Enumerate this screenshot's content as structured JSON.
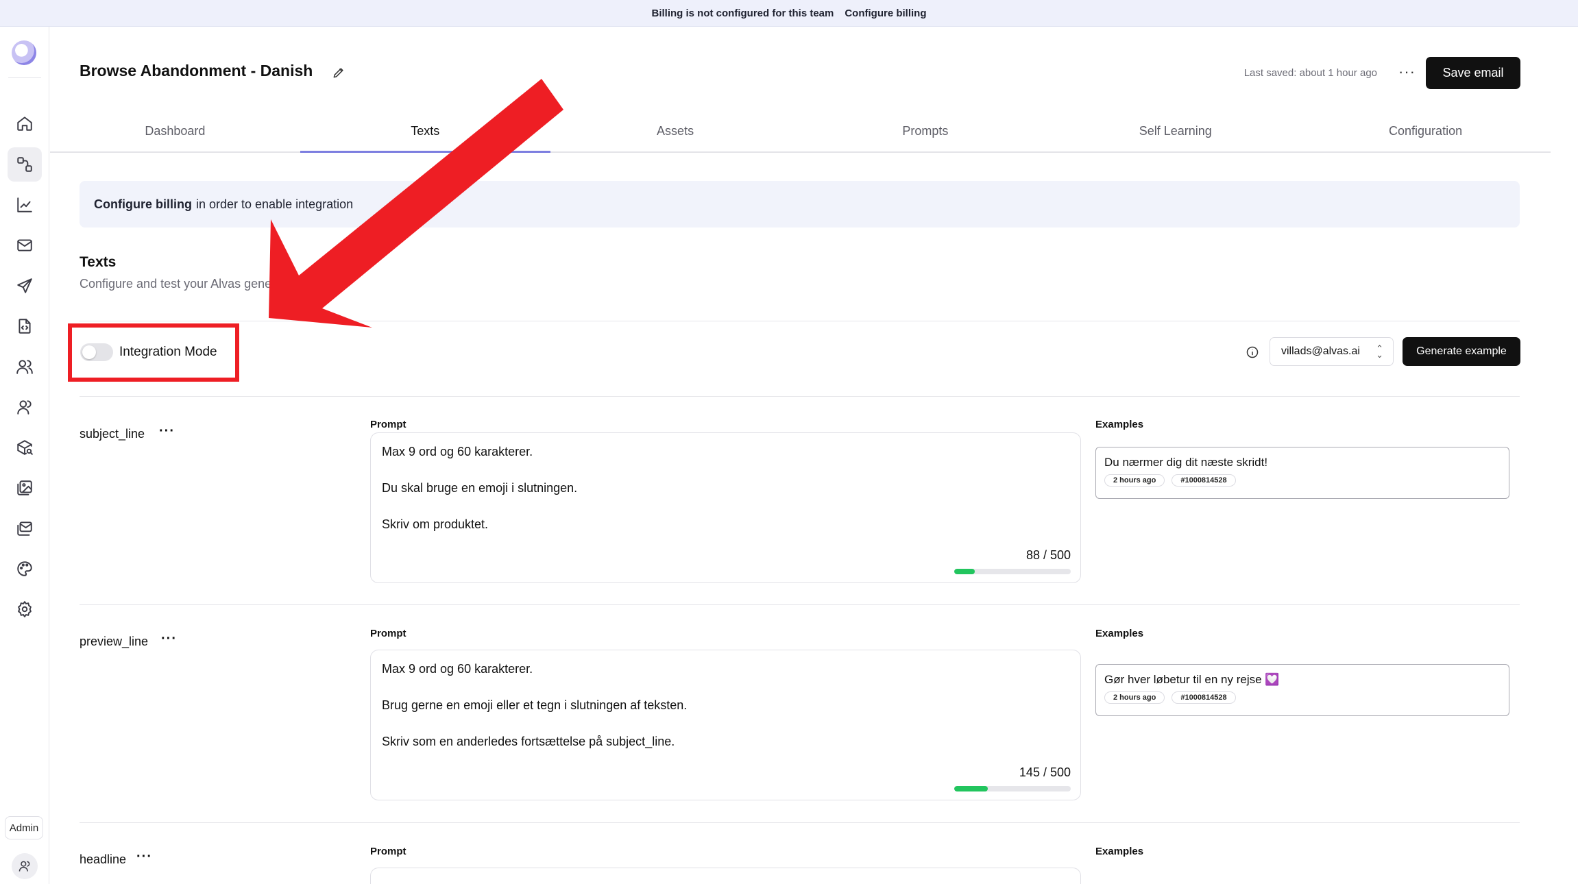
{
  "banner": {
    "message": "Billing is not configured for this team",
    "link": "Configure billing"
  },
  "sidebar": {
    "items": [
      {
        "name": "home"
      },
      {
        "name": "flows"
      },
      {
        "name": "analytics"
      },
      {
        "name": "emails"
      },
      {
        "name": "campaigns"
      },
      {
        "name": "templates"
      },
      {
        "name": "audience"
      },
      {
        "name": "contacts"
      },
      {
        "name": "products"
      },
      {
        "name": "assets"
      },
      {
        "name": "inbox"
      },
      {
        "name": "brand"
      },
      {
        "name": "settings"
      }
    ],
    "admin_label": "Admin"
  },
  "header": {
    "title": "Browse Abandonment - Danish",
    "last_saved": "Last saved: about 1 hour ago",
    "more": "···",
    "save_label": "Save email"
  },
  "tabs": [
    {
      "label": "Dashboard",
      "active": false
    },
    {
      "label": "Texts",
      "active": true
    },
    {
      "label": "Assets",
      "active": false
    },
    {
      "label": "Prompts",
      "active": false
    },
    {
      "label": "Self Learning",
      "active": false
    },
    {
      "label": "Configuration",
      "active": false
    }
  ],
  "alert": {
    "bold": "Configure billing",
    "text": "in order to enable integration"
  },
  "section": {
    "title": "Texts",
    "subtitle": "Configure and test your Alvas generated emails"
  },
  "integration": {
    "label": "Integration Mode",
    "enabled": false
  },
  "test_email": "villads@alvas.ai",
  "generate_label": "Generate example",
  "prompt_label": "Prompt",
  "examples_label": "Examples",
  "fields": [
    {
      "name": "subject_line",
      "more": "···",
      "prompt_lines": [
        "Max 9 ord og 60 karakterer.",
        "Du skal bruge en emoji i slutningen.",
        "Skriv om produktet."
      ],
      "counter": "88 / 500",
      "progress": 0.176,
      "example": {
        "text": "Du nærmer dig dit næste skridt!",
        "time": "2 hours ago",
        "id": "#1000814528"
      }
    },
    {
      "name": "preview_line",
      "more": "···",
      "prompt_lines": [
        "Max 9 ord og 60 karakterer.",
        "Brug gerne en emoji eller et tegn i slutningen af teksten.",
        "Skriv som en anderledes fortsættelse på subject_line."
      ],
      "counter": "145 / 500",
      "progress": 0.29,
      "example": {
        "text": "Gør hver løbetur til en ny rejse 💟",
        "time": "2 hours ago",
        "id": "#1000814528"
      }
    },
    {
      "name": "headline",
      "more": "···"
    }
  ],
  "colors": {
    "accent": "#7c7ee0",
    "progress": "#22c55e",
    "highlight": "#ee1e24"
  }
}
